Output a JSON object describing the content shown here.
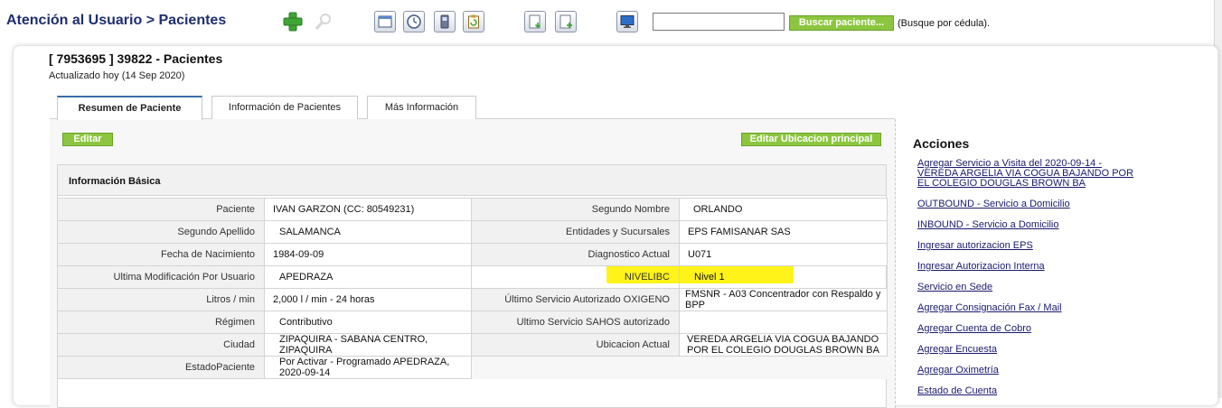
{
  "header": {
    "breadcrumb_root": "Atención al Usuario",
    "breadcrumb_sep": ">",
    "breadcrumb_current": "Pacientes",
    "search": {
      "value": "",
      "button_label": "Buscar paciente...",
      "hint": "(Busque por cédula)."
    }
  },
  "toolbar_icons": [
    "add-icon",
    "search-zoom-icon",
    "calendar-window-icon",
    "clock-icon",
    "phone-icon",
    "clipboard-refresh-icon",
    "document-download-icon",
    "document-add-icon",
    "monitor-icon"
  ],
  "page": {
    "title": "[ 7953695 ] 39822 - Pacientes",
    "subtitle": "Actualizado hoy (14 Sep 2020)"
  },
  "tabs": [
    {
      "label": "Resumen de Paciente",
      "active": true
    },
    {
      "label": "Información de Pacientes",
      "active": false
    },
    {
      "label": "Más Información",
      "active": false
    }
  ],
  "buttons": {
    "edit": "Editar",
    "edit_location": "Editar Ubicacion principal"
  },
  "info": {
    "title": "Información Básica",
    "rows": [
      {
        "l1": "Paciente",
        "v1": "IVAN GARZON (CC: 80549231)",
        "l2": "Segundo Nombre",
        "v2": "ORLANDO"
      },
      {
        "l1": "Segundo Apellido",
        "v1": "SALAMANCA",
        "l2": "Entidades y Sucursales",
        "v2": "EPS FAMISANAR SAS"
      },
      {
        "l1": "Fecha de Nacimiento",
        "v1": "1984-09-09",
        "l2": "Diagnostico Actual",
        "v2": "U071"
      },
      {
        "l1": "Ultima Modificación Por Usuario",
        "v1": "APEDRAZA",
        "l2": "NIVELIBC",
        "v2": "Nivel 1"
      },
      {
        "l1": "Litros / min",
        "v1": "2,000 l / min - 24 horas",
        "l2": "Último Servicio Autorizado OXIGENO",
        "v2": "FMSNR - A03 Concentrador con Respaldo y BPP"
      },
      {
        "l1": "Régimen",
        "v1": "Contributivo",
        "l2": "Ultimo Servicio SAHOS autorizado",
        "v2": ""
      },
      {
        "l1": "Ciudad",
        "v1": "ZIPAQUIRA - SABANA CENTRO, ZIPAQUIRA",
        "l2": "Ubicacion Actual",
        "v2": "VEREDA ARGELIA VIA COGUA BAJANDO POR EL COLEGIO DOUGLAS BROWN BA"
      },
      {
        "l1": "EstadoPaciente",
        "v1": "Por Activar - Programado APEDRAZA, 2020-09-14"
      }
    ]
  },
  "actions": {
    "title": "Acciones",
    "items": [
      "Agregar Servicio a Visita del 2020-09-14 - VEREDA ARGELIA VIA COGUA BAJANDO POR EL COLEGIO DOUGLAS BROWN BA",
      "OUTBOUND - Servicio a Domicilio",
      "INBOUND - Servicio a Domicilio",
      "Ingresar autorizacion EPS",
      "Ingresar Autorizacion Interna",
      "Servicio en Sede",
      "Agregar Consignación Fax / Mail",
      "Agregar Cuenta de Cobro",
      "Agregar Encuesta",
      "Agregar Oximetría",
      "Estado de Cuenta"
    ]
  },
  "colors": {
    "accent_green": "#8cc63f",
    "title_blue": "#1e2f6f",
    "highlight": "#fff200",
    "link": "#1a1a6e"
  }
}
